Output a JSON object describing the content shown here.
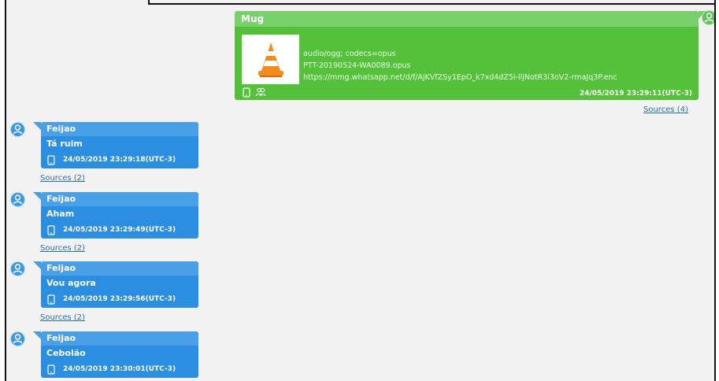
{
  "outgoing": {
    "sender": "Mug",
    "mime": "audio/ogg; codecs=opus",
    "filename": "PTT-20190524-WA0089.opus",
    "url": "https://mmg.whatsapp.net/d/f/AjKVfZSy1EpO_k7xd4dZ5i-lljNotR3i3oV2-rmaJq3P.enc",
    "timestamp": "24/05/2019 23:29:11(UTC-3)",
    "sources": "Sources (4)",
    "icons": [
      "phone-icon",
      "group-icon",
      "vlc-icon",
      "user-avatar-icon"
    ]
  },
  "incoming": [
    {
      "sender": "Feijao",
      "text": "Tá ruim",
      "timestamp": "24/05/2019 23:29:18(UTC-3)",
      "sources": "Sources (2)"
    },
    {
      "sender": "Feijao",
      "text": "Aham",
      "timestamp": "24/05/2019 23:29:49(UTC-3)",
      "sources": "Sources (2)"
    },
    {
      "sender": "Feijao",
      "text": "Vou agora",
      "timestamp": "24/05/2019 23:29:56(UTC-3)",
      "sources": "Sources (2)"
    },
    {
      "sender": "Feijao",
      "text": "Cebolão",
      "timestamp": "24/05/2019 23:30:01(UTC-3)",
      "sources": ""
    }
  ],
  "colors": {
    "outgoing_bubble": "#55c13b",
    "outgoing_header": "#78d06b",
    "incoming_bubble": "#2c8ee0",
    "incoming_header": "#49a0e6",
    "link": "#2e6ea8",
    "background": "#f2f2f2"
  }
}
